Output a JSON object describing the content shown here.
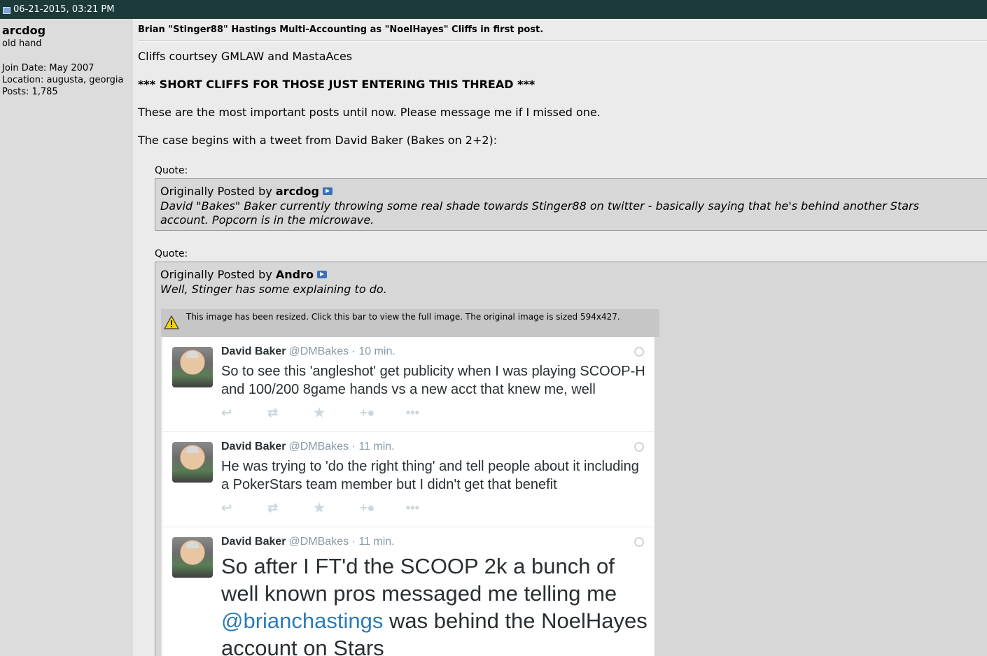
{
  "header": {
    "post_date": "06-21-2015, 03:21 PM"
  },
  "user": {
    "name": "arcdog",
    "title": "old hand",
    "join_date": "Join Date: May 2007",
    "location": "Location: augusta, georgia",
    "posts": "Posts: 1,785"
  },
  "post": {
    "title": "Brian \"Stinger88\" Hastings Multi-Accounting as \"NoelHayes\" Cliffs in first post.",
    "line1": "Cliffs courtsey GMLAW and MastaAces",
    "line2": "*** SHORT CLIFFS FOR THOSE JUST ENTERING THIS THREAD ***",
    "line3": "These are the most important posts until now. Please message me if I missed one.",
    "line4": "The case begins with a tweet from David Baker (Bakes on 2+2):"
  },
  "quotes": [
    {
      "label": "Quote:",
      "prefix": "Originally Posted by",
      "author": "arcdog",
      "text": "David \"Bakes\" Baker currently throwing some real shade towards Stinger88 on twitter - basically saying that he's behind another Stars account. Popcorn is in the microwave."
    },
    {
      "label": "Quote:",
      "prefix": "Originally Posted by",
      "author": "Andro",
      "text": "Well, Stinger has some explaining to do.",
      "resize_notice": "This image has been resized. Click this bar to view the full image. The original image is sized 594x427."
    }
  ],
  "tweets": [
    {
      "name": "David Baker",
      "handle": "@DMBakes · 10 min.",
      "text": "So to see this 'angleshot' get publicity when I was playing SCOOP-H and 100/200 8game hands vs a new acct that knew me, well"
    },
    {
      "name": "David Baker",
      "handle": "@DMBakes · 11 min.",
      "text": "He was trying to 'do the right thing' and tell people about it including a PokerStars team member but I didn't get that benefit"
    },
    {
      "name": "David Baker",
      "handle": "@DMBakes · 11 min.",
      "text_before": "So after I FT'd the SCOOP 2k a bunch of well known pros messaged me telling me ",
      "mention": "@brianchastings",
      "text_after": " was behind the NoelHayes account on Stars"
    }
  ],
  "tweet_actions": [
    "reply-icon",
    "retweet-icon",
    "favorite-icon",
    "follow-icon",
    "more-icon"
  ],
  "colors": {
    "topbar": "#1d3a3b",
    "mention": "#2b7bb9",
    "view_post_icon": "#3b6fb6"
  }
}
